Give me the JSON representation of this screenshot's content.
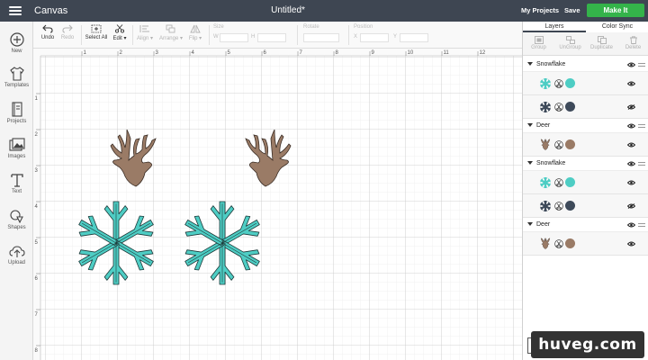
{
  "header": {
    "app_title": "Canvas",
    "doc_title": "Untitled*",
    "my_projects": "My Projects",
    "save": "Save",
    "make_it": "Make It",
    "make_color": "#34b34a"
  },
  "sidebar": {
    "items": [
      {
        "label": "New",
        "icon": "plus-circle-icon"
      },
      {
        "label": "Templates",
        "icon": "shirt-icon"
      },
      {
        "label": "Projects",
        "icon": "book-icon"
      },
      {
        "label": "Images",
        "icon": "images-icon"
      },
      {
        "label": "Text",
        "icon": "text-t-icon"
      },
      {
        "label": "Shapes",
        "icon": "shapes-icon"
      },
      {
        "label": "Upload",
        "icon": "upload-cloud-icon"
      }
    ]
  },
  "toolbar": {
    "undo": "Undo",
    "redo": "Redo",
    "select_all": "Select All",
    "edit": "Edit",
    "align": "Align",
    "arrange": "Arrange",
    "flip": "Flip",
    "size": "Size",
    "size_w": "W",
    "size_h": "H",
    "rotate": "Rotate",
    "position": "Position",
    "pos_x": "X",
    "pos_y": "Y"
  },
  "ruler": {
    "top": [
      "1",
      "2",
      "3",
      "4",
      "5",
      "6",
      "7",
      "8",
      "9",
      "10",
      "11",
      "12"
    ],
    "left": [
      "1",
      "2",
      "3",
      "4",
      "5",
      "6",
      "7",
      "8"
    ]
  },
  "panel": {
    "tab_layers": "Layers",
    "tab_color_sync": "Color Sync",
    "tools": [
      "Group",
      "UnGroup",
      "Duplicate",
      "Delete"
    ],
    "groups": [
      {
        "name": "Snowflake",
        "layers": [
          {
            "type": "snowflake",
            "color": "#4ecdc4",
            "visible": true
          },
          {
            "type": "snowflake",
            "color": "#3e4a5a",
            "visible": false
          }
        ]
      },
      {
        "name": "Deer",
        "layers": [
          {
            "type": "deer",
            "color": "#9a7b66",
            "visible": true
          }
        ]
      },
      {
        "name": "Snowflake",
        "layers": [
          {
            "type": "snowflake",
            "color": "#4ecdc4",
            "visible": true
          },
          {
            "type": "snowflake",
            "color": "#3e4a5a",
            "visible": false
          }
        ]
      },
      {
        "name": "Deer",
        "layers": [
          {
            "type": "deer",
            "color": "#9a7b66",
            "visible": true
          }
        ]
      }
    ]
  },
  "colors": {
    "deer": "#9a7b66",
    "snowflake": "#4ecdc4",
    "snowflake_dark": "#3e4a5a",
    "topbar": "#3e4652"
  },
  "watermark": "huveg.com"
}
